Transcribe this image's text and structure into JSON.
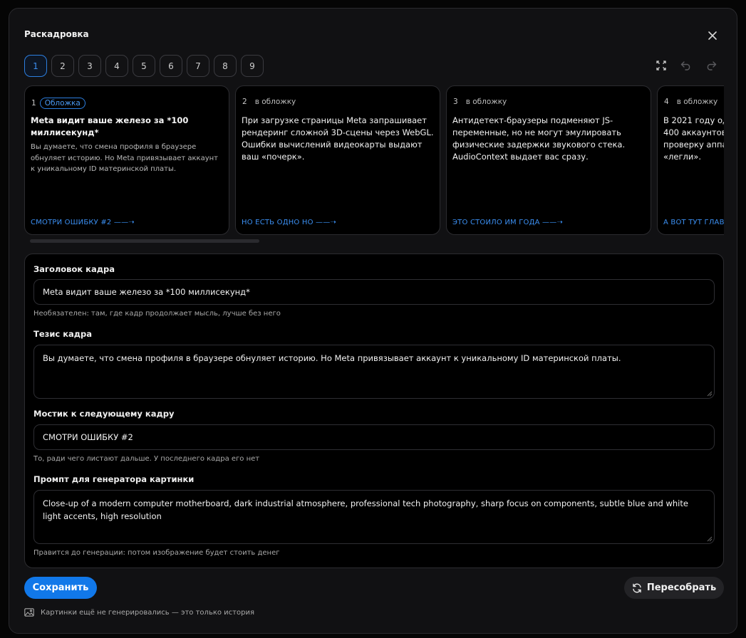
{
  "dialog": {
    "title": "Раскадровка"
  },
  "pager": {
    "pages": [
      "1",
      "2",
      "3",
      "4",
      "5",
      "6",
      "7",
      "8",
      "9"
    ],
    "active": "1"
  },
  "icons": {
    "close": "close-icon",
    "fullscreen": "fullscreen-icon",
    "undo": "undo-icon",
    "redo": "redo-icon",
    "refresh": "refresh-icon",
    "image": "image-icon"
  },
  "cards": [
    {
      "num": "1",
      "badge": "Обложка",
      "title": "Meta видит ваше железо за *100 миллисекунд*",
      "body": "Вы думаете, что смена профиля в браузере обнуляет историю. Но Meta привязывает аккаунт к уникальному ID материнской платы.",
      "link": "СМОТРИ ОШИБКУ #2 ——➝"
    },
    {
      "num": "2",
      "badge": "в обложку",
      "text": "При загрузке страницы Meta запрашивает рендеринг сложной 3D-сцены через WebGL. Ошибки вычислений видеокарты выдают ваш «почерк».",
      "link": "НО ЕСТЬ ОДНО НО ——➝"
    },
    {
      "num": "3",
      "badge": "в обложку",
      "text": "Антидетект-браузеры подменяют JS-переменные, но не могут эмулировать физические задержки звукового стека. AudioContext выдает вас сразу.",
      "link": "ЭТО СТОИЛО ИМ ГОДА ——➝"
    },
    {
      "num": "4",
      "badge": "в обложку",
      "text": "В 2021 году одн\n400 аккаунтов\nпроверку аппа\n«легли».",
      "link": "А ВОТ ТУТ ГЛАВ"
    }
  ],
  "form": {
    "title_label": "Заголовок кадра",
    "title_value": "Meta видит ваше железо за *100 миллисекунд*",
    "title_hint": "Необязателен: там, где кадр продолжает мысль, лучше без него",
    "thesis_label": "Тезис кадра",
    "thesis_value": "Вы думаете, что смена профиля в браузере обнуляет историю. Но Meta привязывает аккаунт к уникальному ID материнской платы.",
    "bridge_label": "Мостик к следующему кадру",
    "bridge_value": "СМОТРИ ОШИБКУ #2",
    "bridge_hint": "То, ради чего листают дальше. У последнего кадра его нет",
    "prompt_label": "Промпт для генератора картинки",
    "prompt_value": "Close-up of a modern computer motherboard, dark industrial atmosphere, professional tech photography, sharp focus on components, subtle blue and white light accents, high resolution",
    "prompt_hint": "Правится до генерации: потом изображение будет стоить денег"
  },
  "actions": {
    "save": "Сохранить",
    "rebuild": "Пересобрать"
  },
  "footer": {
    "note": "Картинки ещё не генерировались — это только история"
  },
  "colors": {
    "accent": "#1178e9",
    "link": "#3b8ff2",
    "background": "#111113"
  }
}
